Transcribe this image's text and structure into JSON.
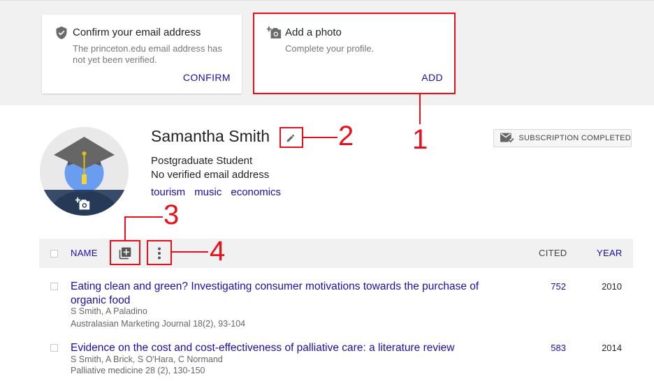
{
  "notices": {
    "confirm": {
      "icon": "shield-check-icon",
      "title": "Confirm your email address",
      "description": "The princeton.edu email address has not yet been verified.",
      "action": "CONFIRM"
    },
    "photo": {
      "icon": "add-photo-icon",
      "title": "Add a photo",
      "description": "Complete your profile.",
      "action": "ADD"
    }
  },
  "profile": {
    "name": "Samantha Smith",
    "affiliation": "Postgraduate Student",
    "email_status": "No verified email address",
    "interests": [
      "tourism",
      "music",
      "economics"
    ],
    "subscription_label": "SUBSCRIPTION COMPLETED",
    "avatar_icon": "graduate-avatar-icon",
    "edit_icon": "pencil-icon"
  },
  "table": {
    "headers": {
      "name": "NAME",
      "cited": "CITED",
      "year": "YEAR"
    },
    "rows": [
      {
        "title": "Eating clean and green? Investigating consumer motivations towards the purchase of organic food",
        "authors": "S Smith, A Paladino",
        "venue": "Australasian Marketing Journal 18(2), 93-104",
        "cited": "752",
        "year": "2010"
      },
      {
        "title": "Evidence on the cost and cost-effectiveness of palliative care: a literature review",
        "authors": "S Smith, A Brick, S O'Hara, C Normand",
        "venue": "Palliative medicine 28 (2), 130-150",
        "cited": "583",
        "year": "2014"
      }
    ]
  },
  "annotations": {
    "one": "1",
    "two": "2",
    "three": "3",
    "four": "4"
  },
  "colors": {
    "link": "#1a0dab",
    "annotation": "#e8101a",
    "banner_bg": "#f1f1f1"
  }
}
